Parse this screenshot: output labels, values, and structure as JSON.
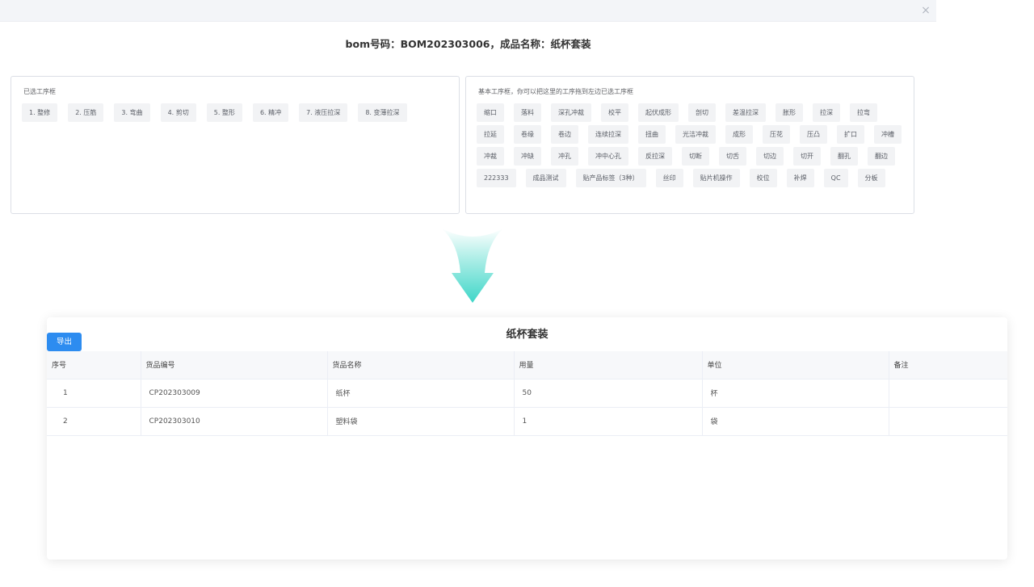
{
  "dialog": {
    "close_icon": "×"
  },
  "bom_header": "bom号码：BOM202303006，成品名称：纸杯套装",
  "selected_panel": {
    "label": "已选工序框",
    "items": [
      "1. 整修",
      "2. 压筋",
      "3. 弯曲",
      "4. 剪切",
      "5. 整形",
      "6. 精冲",
      "7. 液压拉深",
      "8. 变薄拉深"
    ]
  },
  "basic_panel": {
    "label": "基本工序框，你可以把这里的工序拖到左边已选工序框",
    "items": [
      "缩口",
      "落料",
      "深孔冲裁",
      "校平",
      "起伏成形",
      "剖切",
      "差温拉深",
      "胀形",
      "拉深",
      "拉弯",
      "拉延",
      "卷缘",
      "卷边",
      "连续拉深",
      "扭曲",
      "光洁冲裁",
      "成形",
      "压花",
      "压凸",
      "扩口",
      "冲槽",
      "冲裁",
      "冲缺",
      "冲孔",
      "冲中心孔",
      "反拉深",
      "切断",
      "切舌",
      "切边",
      "切开",
      "翻孔",
      "翻边",
      "222333",
      "成品测试",
      "贴产品标签（3种）",
      "丝印",
      "贴片机操作",
      "校位",
      "补焊",
      "QC",
      "分板"
    ]
  },
  "arrow_icon": "arrow-down-icon",
  "result": {
    "export_label": "导出",
    "title": "纸杯套装",
    "columns": [
      "序号",
      "货品编号",
      "货品名称",
      "用量",
      "单位",
      "备注"
    ],
    "rows": [
      [
        "1",
        "CP202303009",
        "纸杯",
        "50",
        "杯",
        ""
      ],
      [
        "2",
        "CP202303010",
        "塑料袋",
        "1",
        "袋",
        ""
      ]
    ]
  },
  "colors": {
    "accent": "#2d8cf0",
    "arrow_top": "#b8f0ea",
    "arrow_bottom": "#3fd6c8"
  }
}
